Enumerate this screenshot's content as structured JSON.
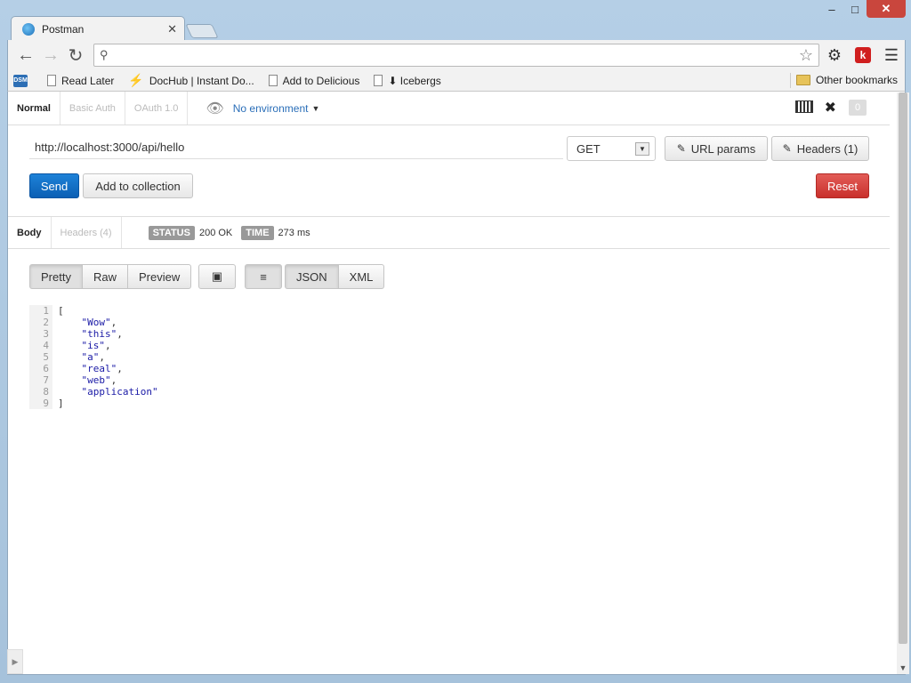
{
  "browser": {
    "tab_title": "Postman",
    "tab_close": "✕",
    "omnibox_value": "",
    "bookmarks": [
      {
        "icon": "dsm-icon",
        "label": "DSM"
      },
      {
        "icon": "page-icon",
        "label": "Read Later"
      },
      {
        "icon": "bolt-icon",
        "label": "DocHub | Instant Do..."
      },
      {
        "icon": "page-icon",
        "label": "Add to Delicious"
      },
      {
        "icon": "page-icon",
        "label": "⬇ Icebergs"
      }
    ],
    "other_bookmarks": "Other bookmarks",
    "extension_badge": "k"
  },
  "auth_tabs": [
    "Normal",
    "Basic Auth",
    "OAuth 1.0"
  ],
  "environment": {
    "label": "No environment"
  },
  "notification_count": "0",
  "request": {
    "url": "http://localhost:3000/api/hello",
    "method": "GET",
    "url_params_label": "URL params",
    "headers_label": "Headers (1)",
    "send_label": "Send",
    "add_collection_label": "Add to collection",
    "reset_label": "Reset"
  },
  "response": {
    "tabs": [
      "Body",
      "Headers (4)"
    ],
    "status_label": "STATUS",
    "status_value": "200 OK",
    "time_label": "TIME",
    "time_value": "273 ms",
    "view_modes": [
      "Pretty",
      "Raw",
      "Preview"
    ],
    "formats": [
      "JSON",
      "XML"
    ],
    "line_numbers": [
      "1",
      "2",
      "3",
      "4",
      "5",
      "6",
      "7",
      "8",
      "9"
    ],
    "body_lines": [
      "[",
      "    \"Wow\",",
      "    \"this\",",
      "    \"is\",",
      "    \"a\",",
      "    \"real\",",
      "    \"web\",",
      "    \"application\"",
      "]"
    ]
  },
  "colors": {
    "send": "#0b5fb4",
    "reset": "#c9302c",
    "json_string": "#1a1aa6",
    "environment_link": "#2a6eb8"
  }
}
